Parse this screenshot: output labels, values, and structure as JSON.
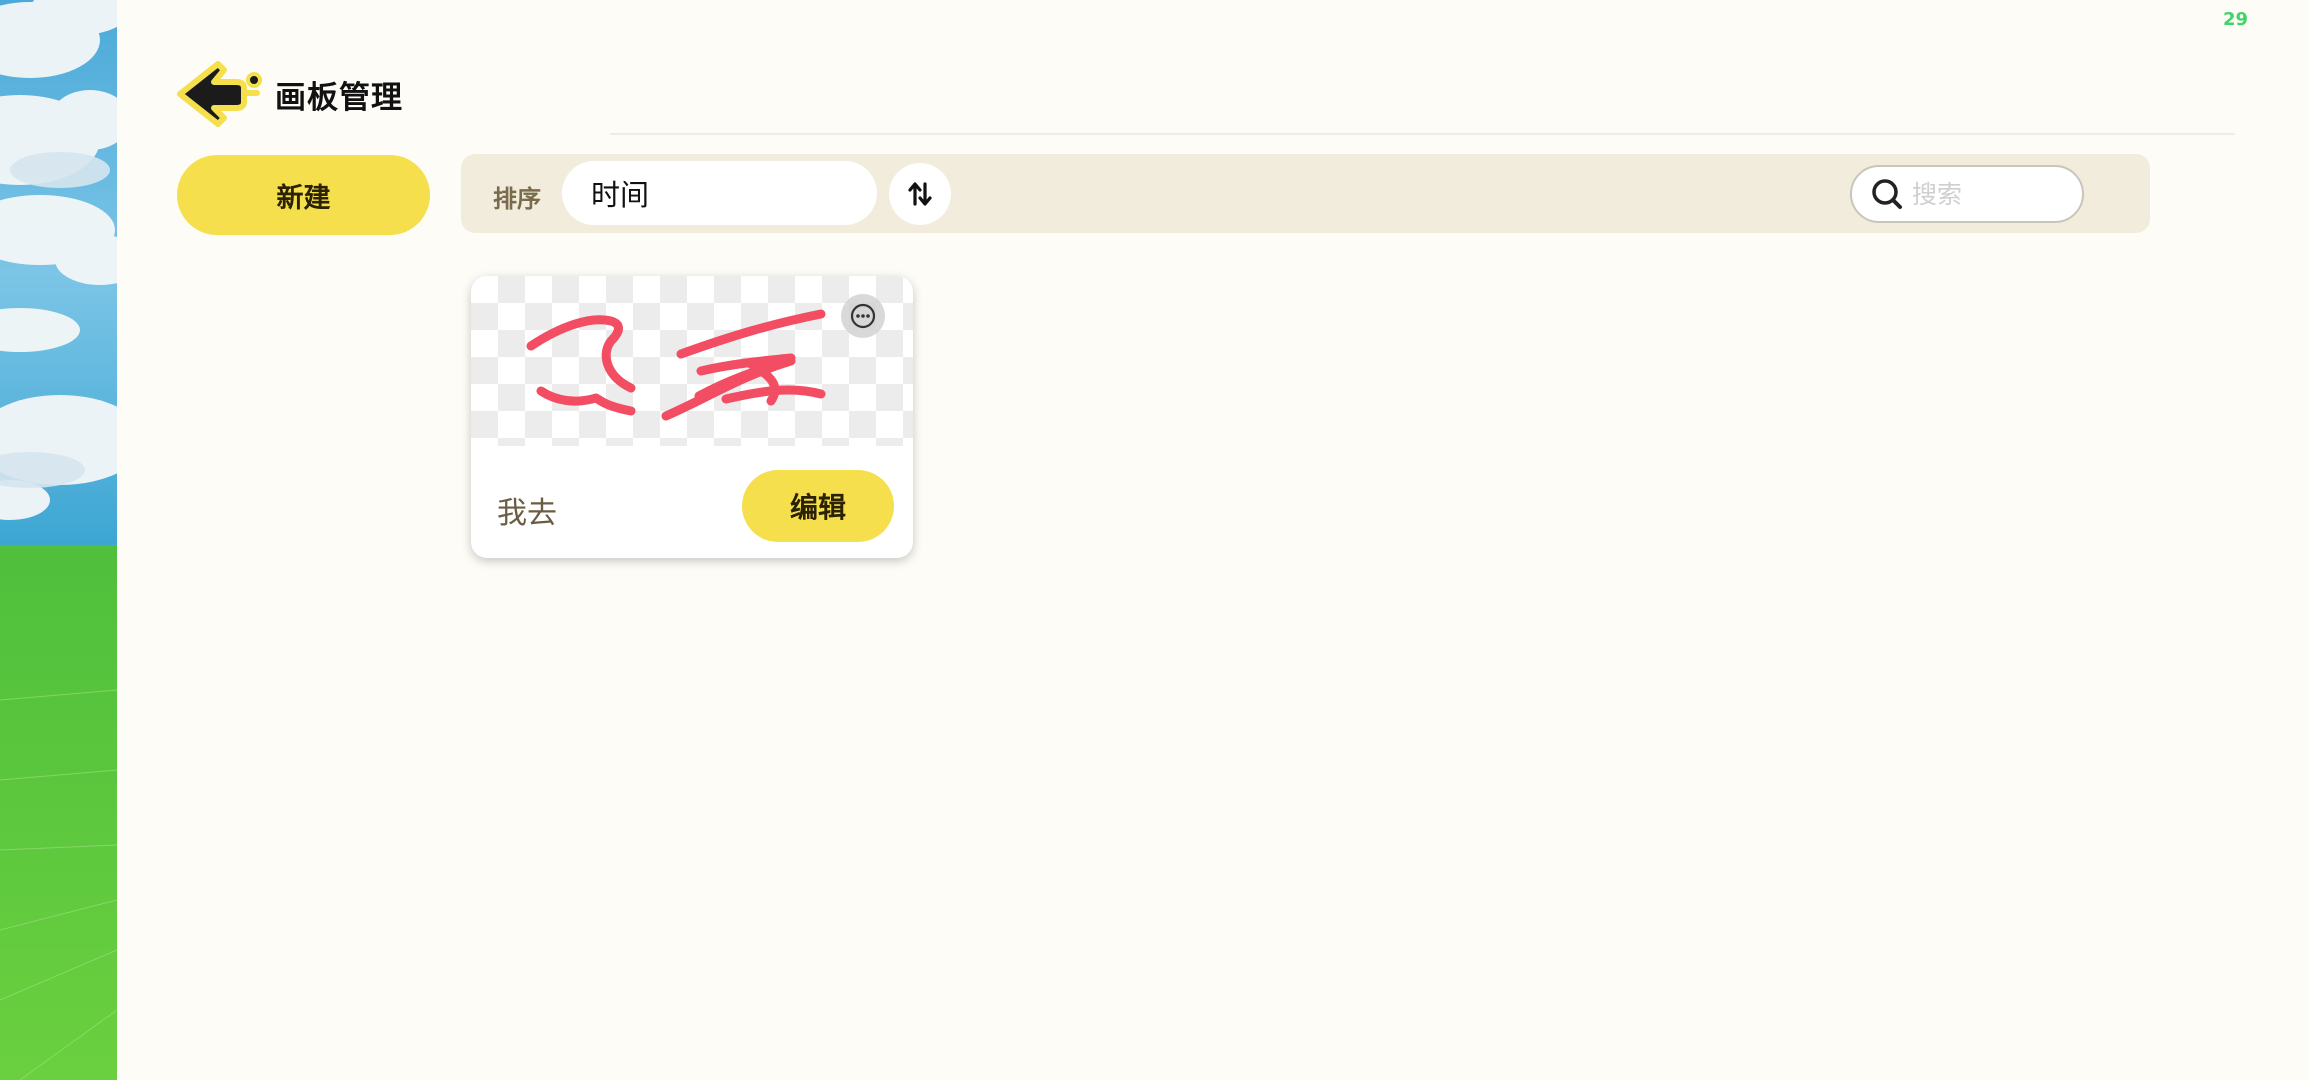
{
  "status": {
    "counter": "29"
  },
  "header": {
    "back_icon": "back-arrow-icon",
    "title": "画板管理"
  },
  "toolbar": {
    "new_label": "新建",
    "sort_label": "排序",
    "sort_value": "时间",
    "sort_order_icon": "sort-toggle-icon",
    "search_icon": "search-icon",
    "search_placeholder": "搜索"
  },
  "boards": [
    {
      "name": "我去",
      "edit_label": "编辑",
      "more_icon": "more-options-icon"
    }
  ],
  "colors": {
    "accent": "#f5df4d",
    "background": "#fefcf6",
    "toolbar": "#f1ecdc",
    "label": "#7a6b4c",
    "stroke": "#f24d62",
    "status": "#3fd46a"
  }
}
